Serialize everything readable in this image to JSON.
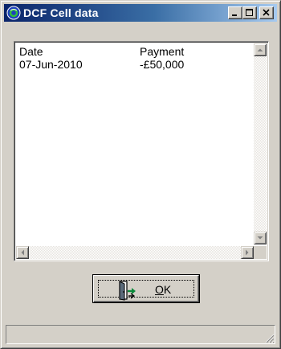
{
  "window": {
    "title": "DCF Cell data",
    "icon": "app-globe-icon",
    "caption_buttons": [
      "minimize-icon",
      "maximize-icon",
      "close-icon"
    ]
  },
  "list": {
    "columns": [
      "Date",
      "Payment"
    ],
    "rows": [
      [
        "07-Jun-2010",
        "-£50,000"
      ]
    ]
  },
  "ok_button": {
    "label_mnemonic": "O",
    "label_rest": "K",
    "icon": "door-exit-icon"
  },
  "statusbar": {
    "text": ""
  },
  "colors": {
    "title_gradient_start": "#0a246a",
    "title_gradient_end": "#a6caf0",
    "face": "#d4d0c8"
  }
}
